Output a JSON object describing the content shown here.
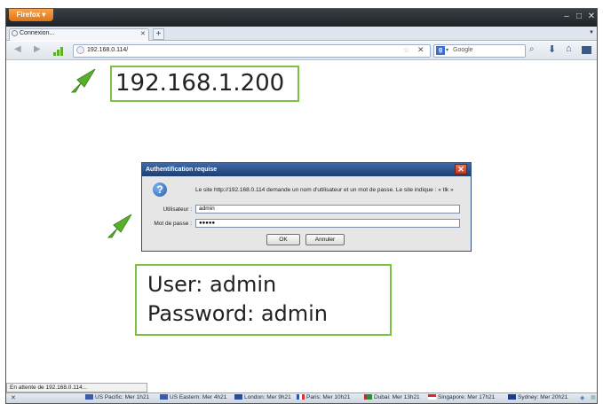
{
  "browser": {
    "menu_button_label": "Firefox ▾",
    "tab_title": "Connexion...",
    "url": "192.168.0.114/",
    "search_placeholder": "Google",
    "window_controls": [
      "minimize-icon",
      "maximize-icon",
      "close-icon"
    ]
  },
  "annotations": {
    "ip_label": "192.168.1.200",
    "credentials_user": "User: admin",
    "credentials_password": "Password: admin",
    "accent_color": "#7dc142"
  },
  "dialog": {
    "title": "Authentification requise",
    "message": "Le site http://192.168.0.114 demande un nom d'utilisateur et un mot de passe. Le site indique : « tlk »",
    "username_label": "Utilisateur :",
    "username_value": "admin",
    "password_label": "Mot de passe :",
    "password_value": "●●●●●",
    "ok_label": "OK",
    "cancel_label": "Annuler"
  },
  "status": {
    "loading_text": "En attente de 192.168.0.114...",
    "clocks": [
      {
        "label": "US Pacific: Mer 1h21",
        "flag_color": "#3c5ba8"
      },
      {
        "label": "US Eastern: Mer 4h21",
        "flag_color": "#3c5ba8"
      },
      {
        "label": "London: Mer 9h21",
        "flag_color": "#2a4e9c"
      },
      {
        "label": "Paris: Mer 10h21",
        "flag_color": "#2a55b8"
      },
      {
        "label": "Dubai: Mer 13h21",
        "flag_color": "#2e8b3a"
      },
      {
        "label": "Singapore: Mer 17h21",
        "flag_color": "#d42a2a"
      },
      {
        "label": "Sydney: Mer 20h21",
        "flag_color": "#1f3b8c"
      }
    ]
  }
}
